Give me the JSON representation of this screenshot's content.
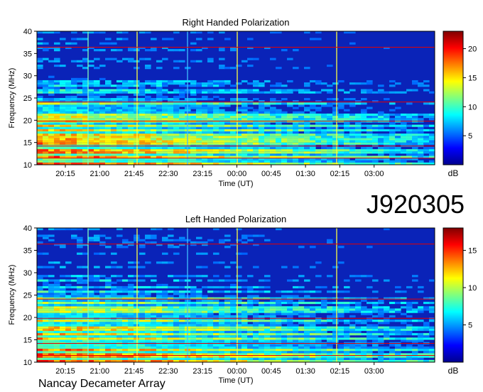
{
  "observation_id": "J920305",
  "instrument": "Nancay Decameter Array",
  "chart_data": [
    {
      "type": "heatmap",
      "title": "Right Handed Polarization",
      "xlabel": "Time (UT)",
      "ylabel": "Frequency (MHz)",
      "x_ticks": [
        "20:15",
        "21:00",
        "21:45",
        "22:30",
        "23:15",
        "00:00",
        "00:45",
        "01:30",
        "02:15",
        "03:00"
      ],
      "y_ticks": [
        10,
        15,
        20,
        25,
        30,
        35,
        40
      ],
      "ylim": [
        10,
        40
      ],
      "colorbar": {
        "ticks": [
          5,
          10,
          15,
          20
        ],
        "unit": "dB",
        "range": [
          0,
          23
        ]
      }
    },
    {
      "type": "heatmap",
      "title": "Left Handed Polarization",
      "xlabel": "Time (UT)",
      "ylabel": "Frequency (MHz)",
      "x_ticks": [
        "20:15",
        "21:00",
        "21:45",
        "22:30",
        "23:15",
        "00:00",
        "00:45",
        "01:30",
        "02:15",
        "03:00"
      ],
      "y_ticks": [
        10,
        15,
        20,
        25,
        30,
        35,
        40
      ],
      "ylim": [
        10,
        40
      ],
      "colorbar": {
        "ticks": [
          5,
          10,
          15
        ],
        "unit": "dB",
        "range": [
          0,
          18
        ]
      }
    }
  ]
}
